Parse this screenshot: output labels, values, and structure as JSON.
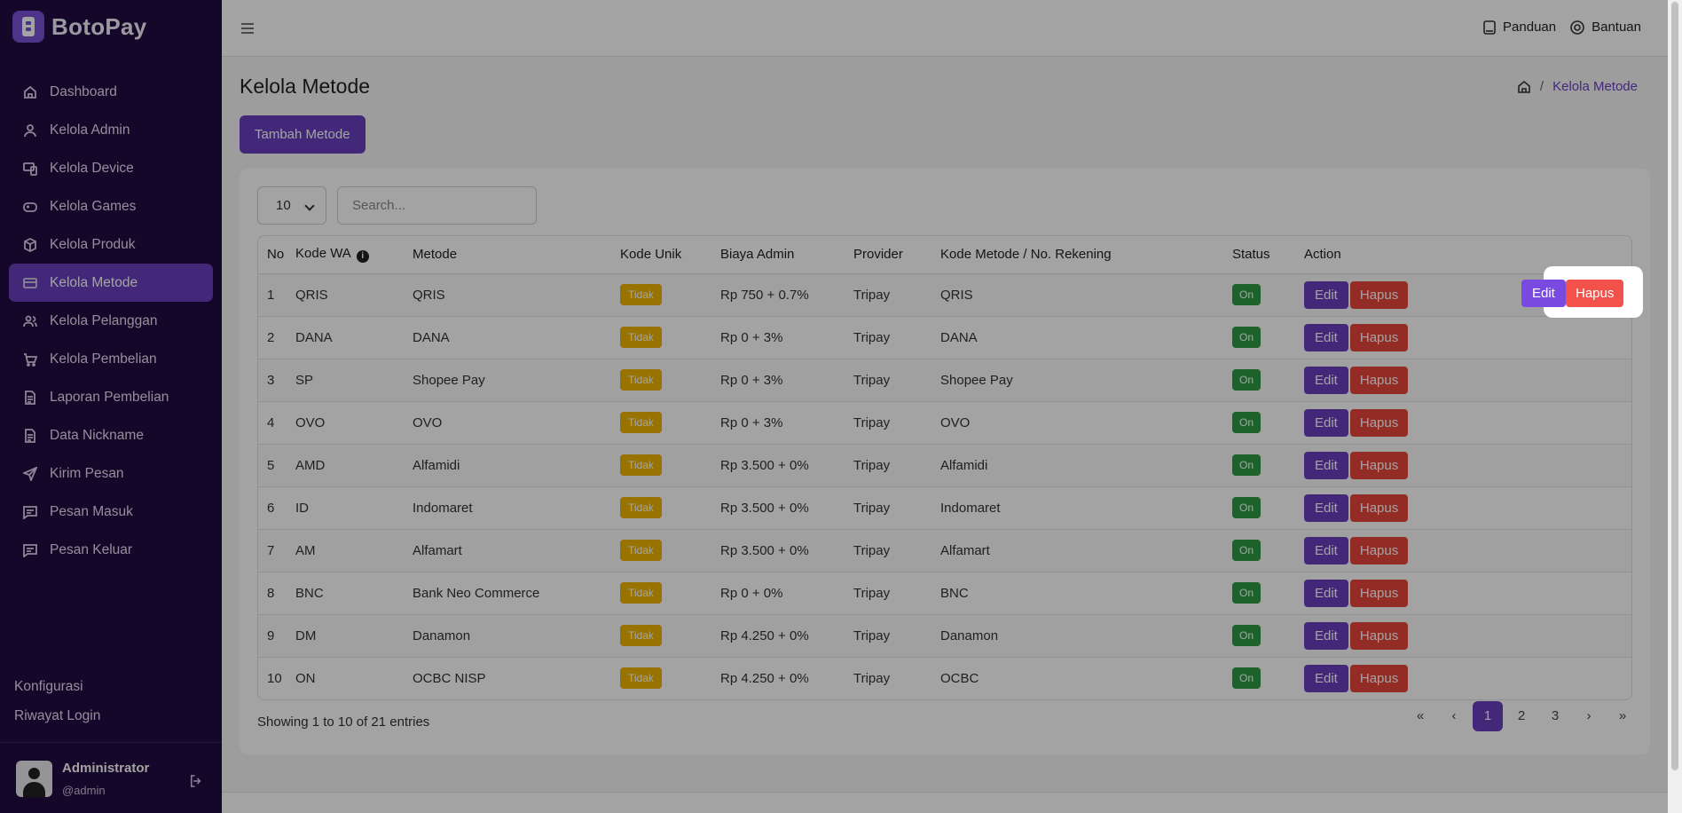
{
  "brand": {
    "name": "BotoPay"
  },
  "sidebar": {
    "items": [
      {
        "label": "Dashboard",
        "icon": "home-icon",
        "active": false
      },
      {
        "label": "Kelola Admin",
        "icon": "user-icon",
        "active": false
      },
      {
        "label": "Kelola Device",
        "icon": "devices-icon",
        "active": false
      },
      {
        "label": "Kelola Games",
        "icon": "gamepad-icon",
        "active": false
      },
      {
        "label": "Kelola Produk",
        "icon": "box-icon",
        "active": false
      },
      {
        "label": "Kelola Metode",
        "icon": "credit-card-icon",
        "active": true
      },
      {
        "label": "Kelola Pelanggan",
        "icon": "users-icon",
        "active": false
      },
      {
        "label": "Kelola Pembelian",
        "icon": "cart-icon",
        "active": false
      },
      {
        "label": "Laporan Pembelian",
        "icon": "document-icon",
        "active": false
      },
      {
        "label": "Data Nickname",
        "icon": "document-icon",
        "active": false
      },
      {
        "label": "Kirim Pesan",
        "icon": "send-icon",
        "active": false
      },
      {
        "label": "Pesan Masuk",
        "icon": "message-icon",
        "active": false
      },
      {
        "label": "Pesan Keluar",
        "icon": "message-icon",
        "active": false
      }
    ],
    "footer": {
      "config": "Konfigurasi",
      "login_history": "Riwayat Login"
    },
    "user": {
      "name": "Administrator",
      "handle": "@admin"
    }
  },
  "topbar": {
    "guide": "Panduan",
    "help": "Bantuan"
  },
  "page": {
    "title": "Kelola Metode",
    "breadcrumb": "Kelola Metode",
    "add_button": "Tambah Metode",
    "page_size": "10",
    "search_placeholder": "Search...",
    "showing": "Showing 1 to 10 of 21 entries"
  },
  "table": {
    "headers": [
      "No",
      "Kode WA",
      "Metode",
      "Kode Unik",
      "Biaya Admin",
      "Provider",
      "Kode Metode / No. Rekening",
      "Status",
      "Action"
    ],
    "rows": [
      {
        "no": "1",
        "kode": "QRIS",
        "metode": "QRIS",
        "unik": "Tidak",
        "biaya": "Rp 750 + 0.7%",
        "provider": "Tripay",
        "rekening": "QRIS",
        "status": "On"
      },
      {
        "no": "2",
        "kode": "DANA",
        "metode": "DANA",
        "unik": "Tidak",
        "biaya": "Rp 0 + 3%",
        "provider": "Tripay",
        "rekening": "DANA",
        "status": "On"
      },
      {
        "no": "3",
        "kode": "SP",
        "metode": "Shopee Pay",
        "unik": "Tidak",
        "biaya": "Rp 0 + 3%",
        "provider": "Tripay",
        "rekening": "Shopee Pay",
        "status": "On"
      },
      {
        "no": "4",
        "kode": "OVO",
        "metode": "OVO",
        "unik": "Tidak",
        "biaya": "Rp 0 + 3%",
        "provider": "Tripay",
        "rekening": "OVO",
        "status": "On"
      },
      {
        "no": "5",
        "kode": "AMD",
        "metode": "Alfamidi",
        "unik": "Tidak",
        "biaya": "Rp 3.500 + 0%",
        "provider": "Tripay",
        "rekening": "Alfamidi",
        "status": "On"
      },
      {
        "no": "6",
        "kode": "ID",
        "metode": "Indomaret",
        "unik": "Tidak",
        "biaya": "Rp 3.500 + 0%",
        "provider": "Tripay",
        "rekening": "Indomaret",
        "status": "On"
      },
      {
        "no": "7",
        "kode": "AM",
        "metode": "Alfamart",
        "unik": "Tidak",
        "biaya": "Rp 3.500 + 0%",
        "provider": "Tripay",
        "rekening": "Alfamart",
        "status": "On"
      },
      {
        "no": "8",
        "kode": "BNC",
        "metode": "Bank Neo Commerce",
        "unik": "Tidak",
        "biaya": "Rp 0 + 0%",
        "provider": "Tripay",
        "rekening": "BNC",
        "status": "On"
      },
      {
        "no": "9",
        "kode": "DM",
        "metode": "Danamon",
        "unik": "Tidak",
        "biaya": "Rp 4.250 + 0%",
        "provider": "Tripay",
        "rekening": "Danamon",
        "status": "On"
      },
      {
        "no": "10",
        "kode": "ON",
        "metode": "OCBC NISP",
        "unik": "Tidak",
        "biaya": "Rp 4.250 + 0%",
        "provider": "Tripay",
        "rekening": "OCBC",
        "status": "On"
      }
    ],
    "edit_label": "Edit",
    "delete_label": "Hapus"
  },
  "pagination": {
    "first": "«",
    "prev": "‹",
    "pages": [
      "1",
      "2",
      "3"
    ],
    "current": "1",
    "next": "›",
    "last": "»"
  },
  "colors": {
    "sidebar_bg": "#210b43",
    "accent": "#6a3fbd",
    "danger": "#e8453c",
    "warning": "#f0b400",
    "success": "#2f9a44"
  }
}
